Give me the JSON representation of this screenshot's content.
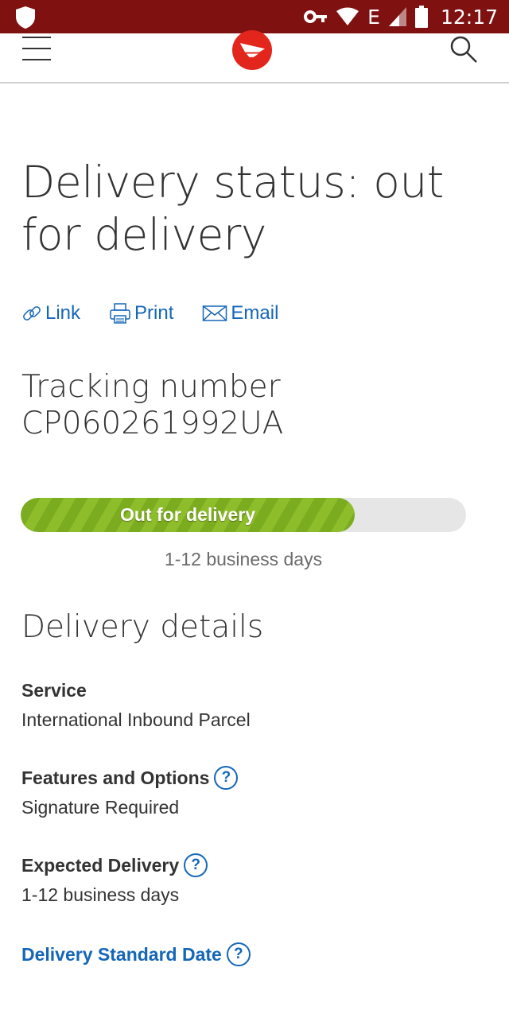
{
  "status_bar": {
    "time": "12:17",
    "network": "E",
    "icons": [
      "shield-icon",
      "key-icon",
      "wifi-icon",
      "signal-icon",
      "battery-icon"
    ]
  },
  "header": {
    "icons": [
      "menu-icon",
      "canada-post-logo",
      "search-icon"
    ],
    "brand_color": "#e2261c"
  },
  "page": {
    "title": "Delivery status: out for delivery",
    "actions": {
      "link": "Link",
      "print": "Print",
      "email": "Email"
    },
    "tracking_label": "Tracking number",
    "tracking_number": "CP060261992UA"
  },
  "progress": {
    "label": "Out for delivery",
    "fraction": 0.75,
    "subtext": "1-12 business days",
    "fill_color": "#7bab1e"
  },
  "details": {
    "title": "Delivery details",
    "service": {
      "label": "Service",
      "value": "International Inbound Parcel"
    },
    "features": {
      "label": "Features and Options",
      "value": "Signature Required"
    },
    "expected": {
      "label": "Expected Delivery",
      "value": "1-12 business days"
    },
    "standard_date": {
      "label": "Delivery Standard Date"
    },
    "help_glyph": "?"
  },
  "colors": {
    "status_bar": "#7f1111",
    "link": "#1466b8",
    "text": "#333333"
  }
}
